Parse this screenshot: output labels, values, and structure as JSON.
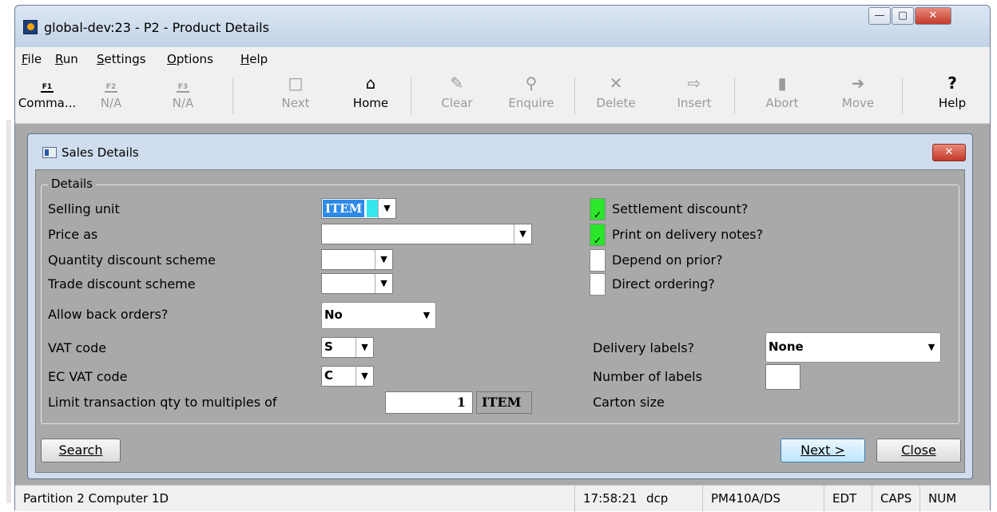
{
  "window": {
    "title": "global-dev:23 - P2 - Product Details"
  },
  "menu": [
    {
      "ul": "F",
      "rest": "ile"
    },
    {
      "ul": "R",
      "rest": "un"
    },
    {
      "ul": "S",
      "rest": "ettings"
    },
    {
      "ul": "O",
      "rest": "ptions"
    },
    {
      "ul": "H",
      "rest": "elp"
    }
  ],
  "toolbar": {
    "commands": "Comma...",
    "f2": "N/A",
    "f3": "N/A",
    "next": "Next",
    "home": "Home",
    "clear": "Clear",
    "enquire": "Enquire",
    "delete": "Delete",
    "insert": "Insert",
    "abort": "Abort",
    "move": "Move",
    "help": "Help",
    "fkey_f1": "F1",
    "fkey_f2": "F2",
    "fkey_f3": "F3"
  },
  "dialog": {
    "title": "Sales Details",
    "group_title": "Details",
    "fields": {
      "selling_unit_label": "Selling unit",
      "selling_unit_value": "ITEM",
      "price_as_label": "Price as",
      "price_as_value": "",
      "qty_discount_label": "Quantity discount scheme",
      "qty_discount_value": "",
      "trade_discount_label": "Trade discount scheme",
      "trade_discount_value": "",
      "back_orders_label": "Allow back orders?",
      "back_orders_value": "No",
      "vat_code_label": "VAT code",
      "vat_code_value": "S",
      "ec_vat_code_label": "EC VAT code",
      "ec_vat_code_value": "C",
      "limit_qty_label": "Limit transaction qty to multiples of",
      "limit_qty_value": "1",
      "limit_qty_unit": "ITEM",
      "settlement_label": "Settlement discount?",
      "settlement_checked": true,
      "print_delivery_label": "Print on delivery notes?",
      "print_delivery_checked": true,
      "depend_prior_label": "Depend on prior?",
      "depend_prior_checked": false,
      "direct_ordering_label": "Direct ordering?",
      "direct_ordering_checked": false,
      "delivery_labels_label": "Delivery labels?",
      "delivery_labels_value": "None",
      "number_labels_label": "Number of labels",
      "number_labels_value": "",
      "carton_size_label": "Carton size"
    },
    "buttons": {
      "search": "Search",
      "next": "Next >",
      "close": "Close"
    }
  },
  "status": {
    "partition": "Partition 2 Computer 1D",
    "time": "17:58:21",
    "user": "dcp",
    "program": "PM410A/DS",
    "edt": "EDT",
    "caps": "CAPS",
    "num": "NUM"
  },
  "colors": {
    "checkbox_on": "#2be62b",
    "selection": "#2d8ae8",
    "form_bg": "#a9a9a9",
    "chrome": "#c8d6e6"
  }
}
